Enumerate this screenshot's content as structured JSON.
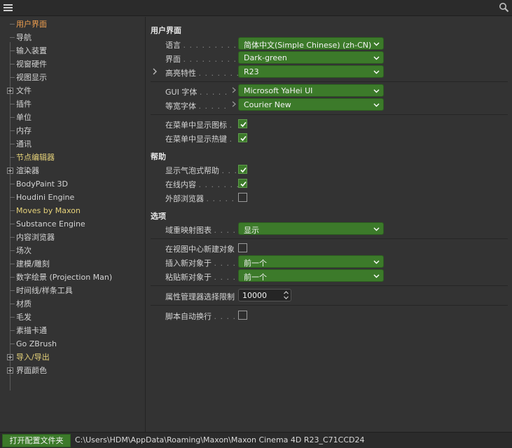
{
  "icons": {
    "menu": "hamburger-icon",
    "search": "search-icon"
  },
  "colors": {
    "accent_green": "#3c7a2a",
    "selected_orange": "#f0a050",
    "plugin_yellow": "#e6d27a",
    "background": "#333333"
  },
  "sidebar": {
    "items": [
      {
        "label": "用户界面",
        "style": "orange"
      },
      {
        "label": "导航"
      },
      {
        "label": "输入装置"
      },
      {
        "label": "视窗硬件"
      },
      {
        "label": "视图显示"
      },
      {
        "label": "文件",
        "expandable": true
      },
      {
        "label": "插件"
      },
      {
        "label": "单位"
      },
      {
        "label": "内存"
      },
      {
        "label": "通讯"
      },
      {
        "label": "节点编辑器",
        "style": "yellow"
      },
      {
        "label": "渲染器",
        "expandable": true
      },
      {
        "label": "BodyPaint 3D"
      },
      {
        "label": "Houdini Engine"
      },
      {
        "label": "Moves by Maxon",
        "style": "yellow"
      },
      {
        "label": "Substance Engine"
      },
      {
        "label": "内容浏览器"
      },
      {
        "label": "场次"
      },
      {
        "label": "建模/雕刻"
      },
      {
        "label": "数字绘景 (Projection Man)"
      },
      {
        "label": "时间线/样条工具"
      },
      {
        "label": "材质"
      },
      {
        "label": "毛发"
      },
      {
        "label": "素描卡通"
      },
      {
        "label": "Go ZBrush"
      },
      {
        "label": "导入/导出",
        "style": "yellow",
        "expandable": true
      },
      {
        "label": "界面颜色",
        "expandable": true
      }
    ]
  },
  "main": {
    "section_ui": "用户界面",
    "language_label": "语言",
    "language_dots": ". . . . . . . . . . . .",
    "language_value": "简体中文(Simple Chinese) (zh-CN)",
    "scheme_label": "界面",
    "scheme_dots": ". . . . . . . . . . . .",
    "scheme_value": "Dark-green",
    "highlight_label": "高亮特性",
    "highlight_dots": ". . . . . . . .",
    "highlight_value": "R23",
    "gui_font_label": "GUI 字体",
    "gui_font_dots": ". . . . .",
    "gui_font_value": "Microsoft YaHei UI",
    "mono_font_label": "等宽字体",
    "mono_font_dots": ". . . . .",
    "mono_font_value": "Courier New",
    "show_icons_label": "在菜单中显示图标",
    "show_icons_dots": ".",
    "show_icons_checked": true,
    "show_hotkeys_label": "在菜单中显示热键",
    "show_hotkeys_dots": ".",
    "show_hotkeys_checked": true,
    "section_help": "帮助",
    "bubble_help_label": "显示气泡式帮助",
    "bubble_help_dots": ". . .",
    "bubble_help_checked": true,
    "online_content_label": "在线内容",
    "online_content_dots": ". . . . . . . .",
    "online_content_checked": true,
    "external_browser_label": "外部浏览器",
    "external_browser_dots": ". . . . . .",
    "external_browser_checked": false,
    "section_options": "选项",
    "gamut_label": "域重映射图表",
    "gamut_dots": ". . . .",
    "gamut_value": "显示",
    "center_new_label": "在视图中心新建对象",
    "center_new_checked": false,
    "insert_at_label": "插入新对象于",
    "insert_at_dots": ". . . . .",
    "insert_at_value": "前一个",
    "paste_at_label": "粘贴新对象于",
    "paste_at_dots": ". . . . .",
    "paste_at_value": "前一个",
    "attr_limit_label": "属性管理器选择限制",
    "attr_limit_value": "10000",
    "script_wrap_label": "脚本自动换行",
    "script_wrap_dots": ". . . . .",
    "script_wrap_checked": false
  },
  "footer": {
    "open_button": "打开配置文件夹",
    "path": "C:\\Users\\HDM\\AppData\\Roaming\\Maxon\\Maxon Cinema 4D R23_C71CCD24"
  }
}
